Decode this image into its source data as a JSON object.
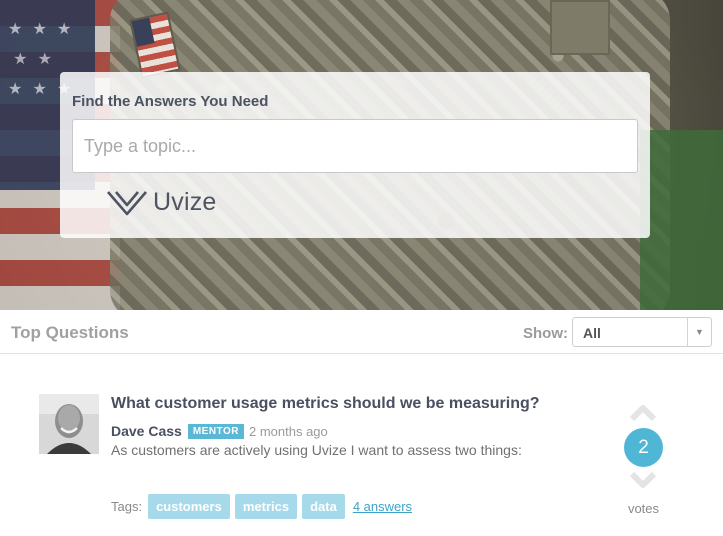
{
  "search": {
    "title": "Find the Answers You Need",
    "placeholder": "Type a topic...",
    "brand": "Uvize"
  },
  "questions_bar": {
    "title": "Top Questions",
    "show_label": "Show:",
    "show_value": "All"
  },
  "question": {
    "title": "What customer usage metrics should we be measuring?",
    "author": "Dave Cass",
    "badge": "MENTOR",
    "time": "2 months ago",
    "excerpt": "As customers are actively using Uvize I want to assess two things:",
    "tags_label": "Tags:",
    "tags": [
      "customers",
      "metrics",
      "data"
    ],
    "answers": "4 answers",
    "votes": "2",
    "votes_label": "votes"
  },
  "colors": {
    "accent": "#4fb6d6",
    "tag": "#a6d9ea",
    "badge": "#5ab7d6",
    "link": "#3ea3c9"
  },
  "icons": {
    "logo": "uvize-logo-icon",
    "vote_up": "chevron-up-icon",
    "vote_down": "chevron-down-icon",
    "select": "caret-down-icon"
  }
}
